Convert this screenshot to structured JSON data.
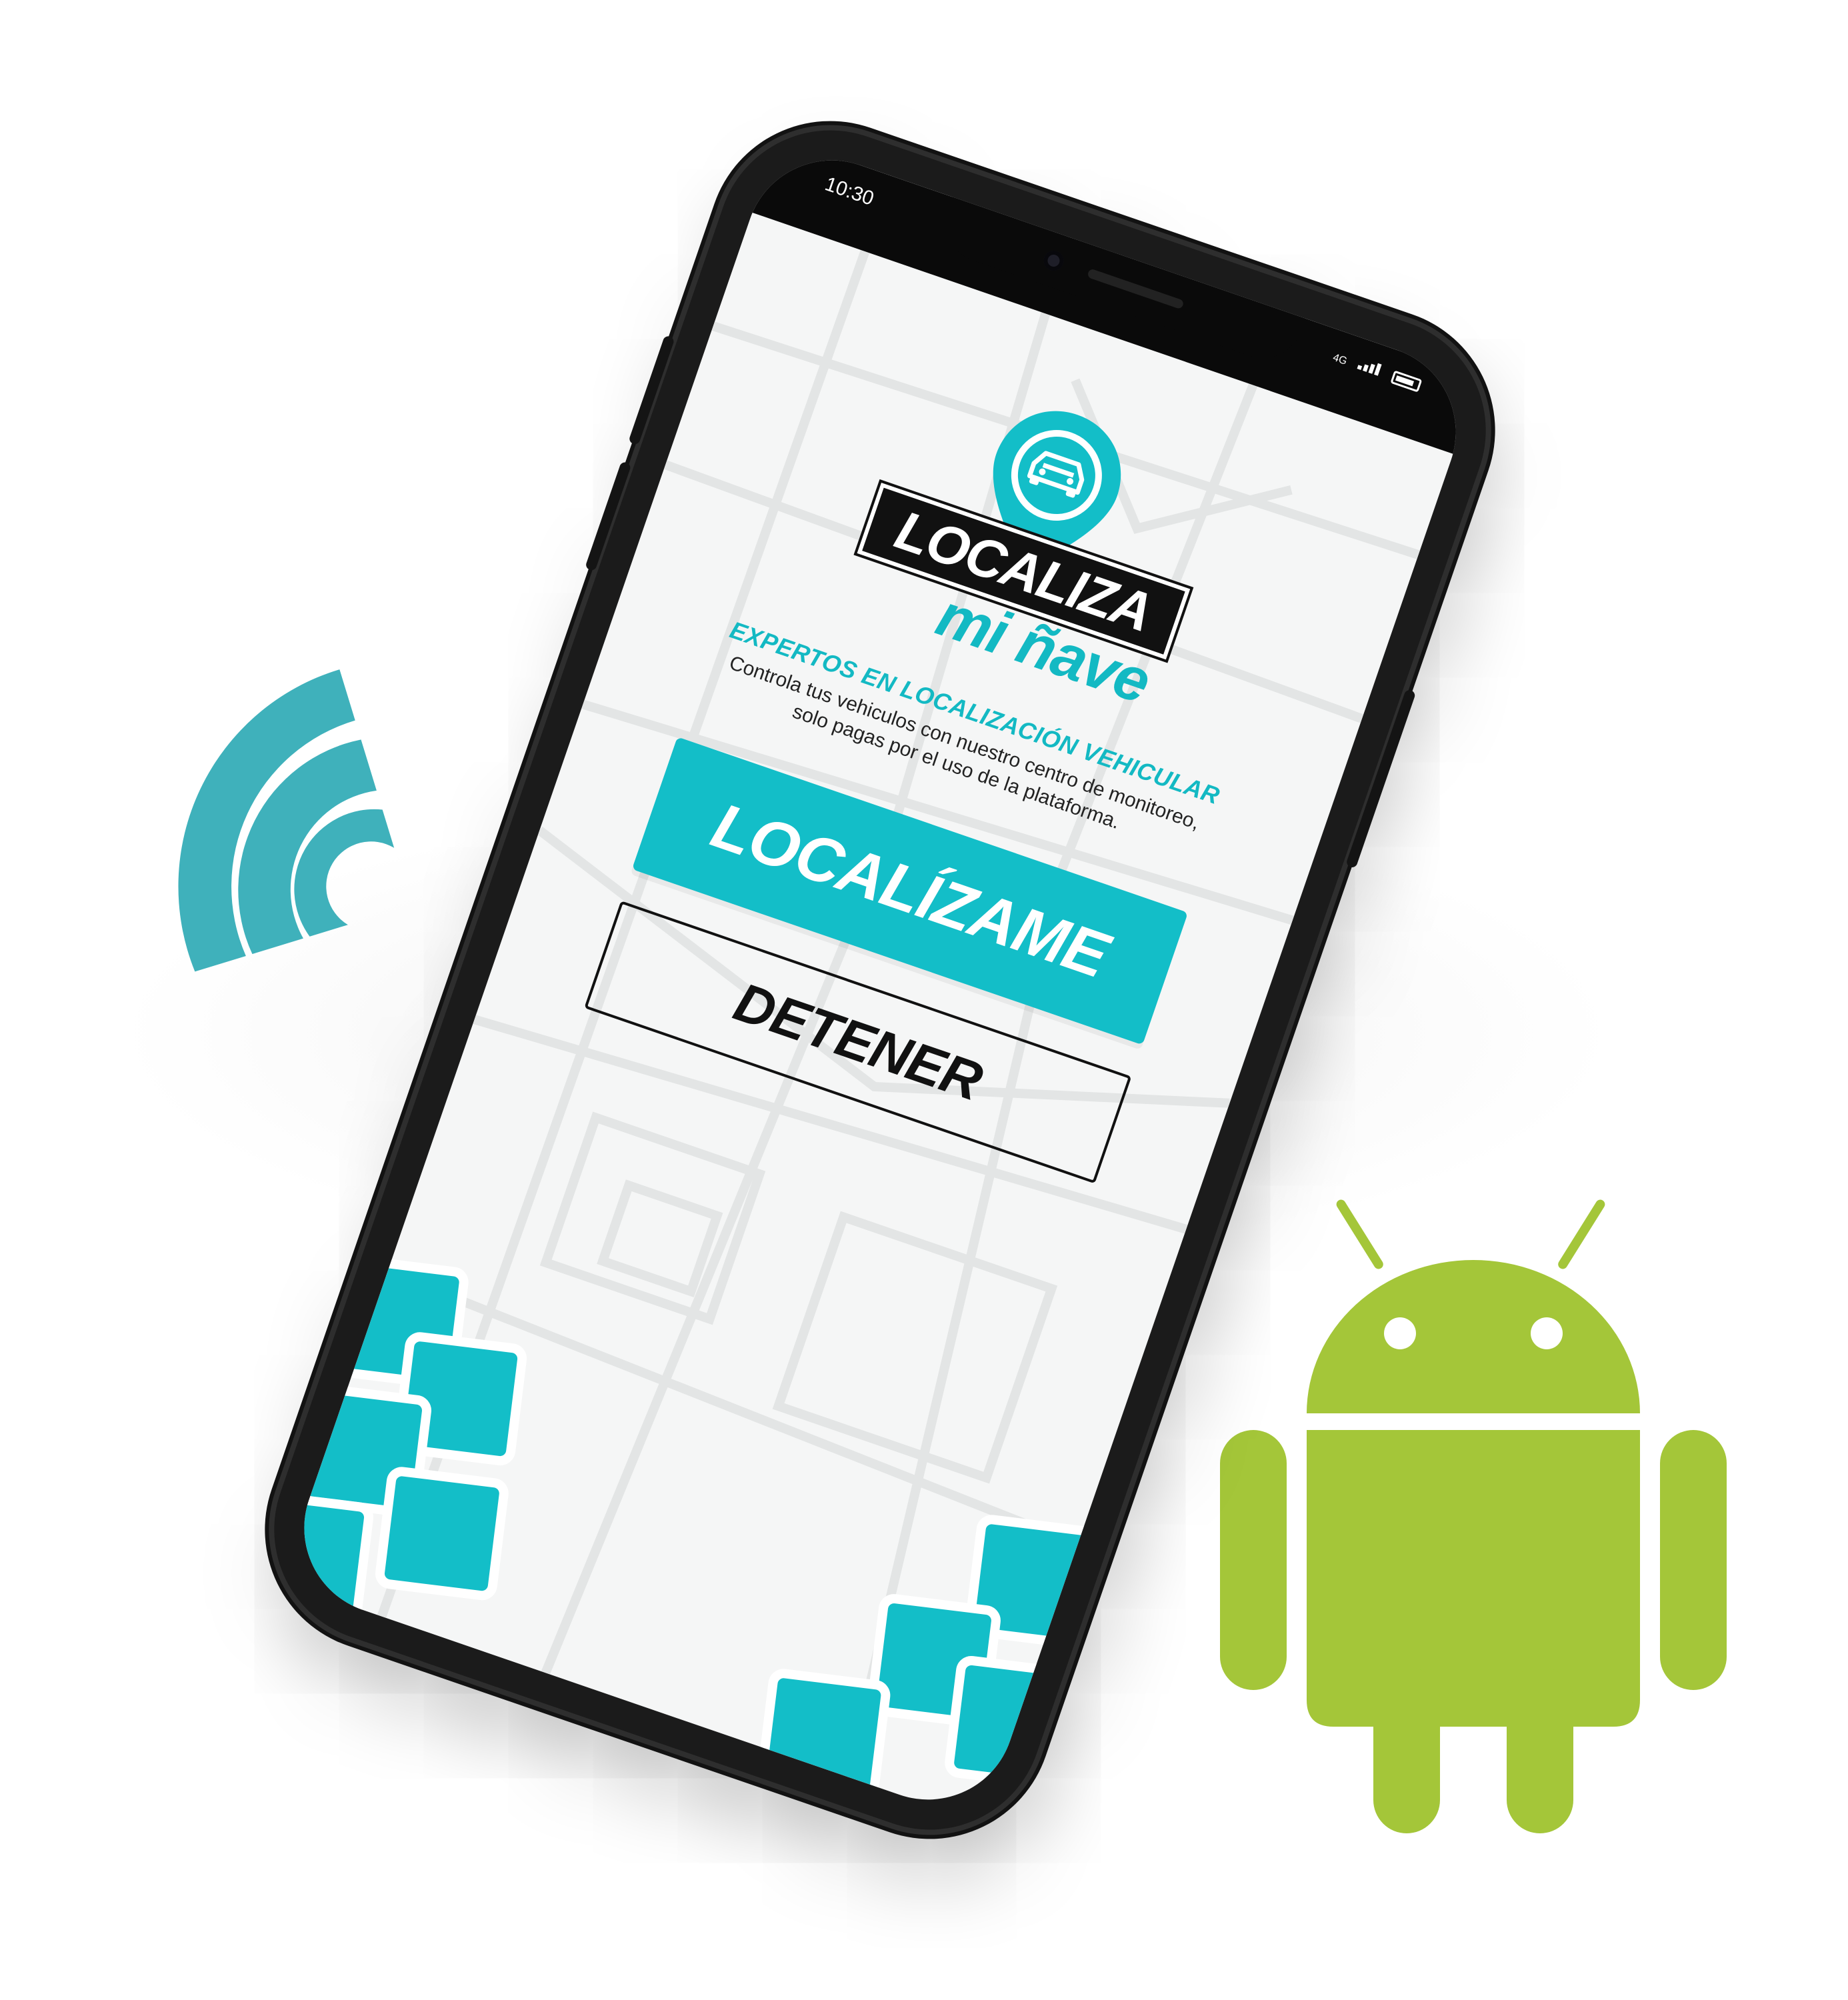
{
  "status_bar": {
    "time": "10:30",
    "network": "4G"
  },
  "logo": {
    "top_word": "LOCALIZA",
    "bottom_word": "mi ñave"
  },
  "tagline": {
    "title": "EXPERTOS EN LOCALIZACIÓN VEHICULAR",
    "line1": "Controla tus vehiculos con nuestro centro de monitoreo,",
    "line2": "solo pagas por el uso de la plataforma."
  },
  "buttons": {
    "locate_label": "LOCALÍZAME",
    "stop_label": "DETENER"
  },
  "colors": {
    "accent_teal": "#13bec8",
    "wifi_teal": "#3fb1bb",
    "android_green": "#a4c639",
    "phone_frame": "#1b1b1b"
  },
  "icons": {
    "wifi": "wifi-signal-icon",
    "android": "android-robot-icon",
    "car": "car-icon",
    "pin": "location-pin-icon",
    "battery": "battery-icon",
    "signal": "cell-signal-icon"
  }
}
